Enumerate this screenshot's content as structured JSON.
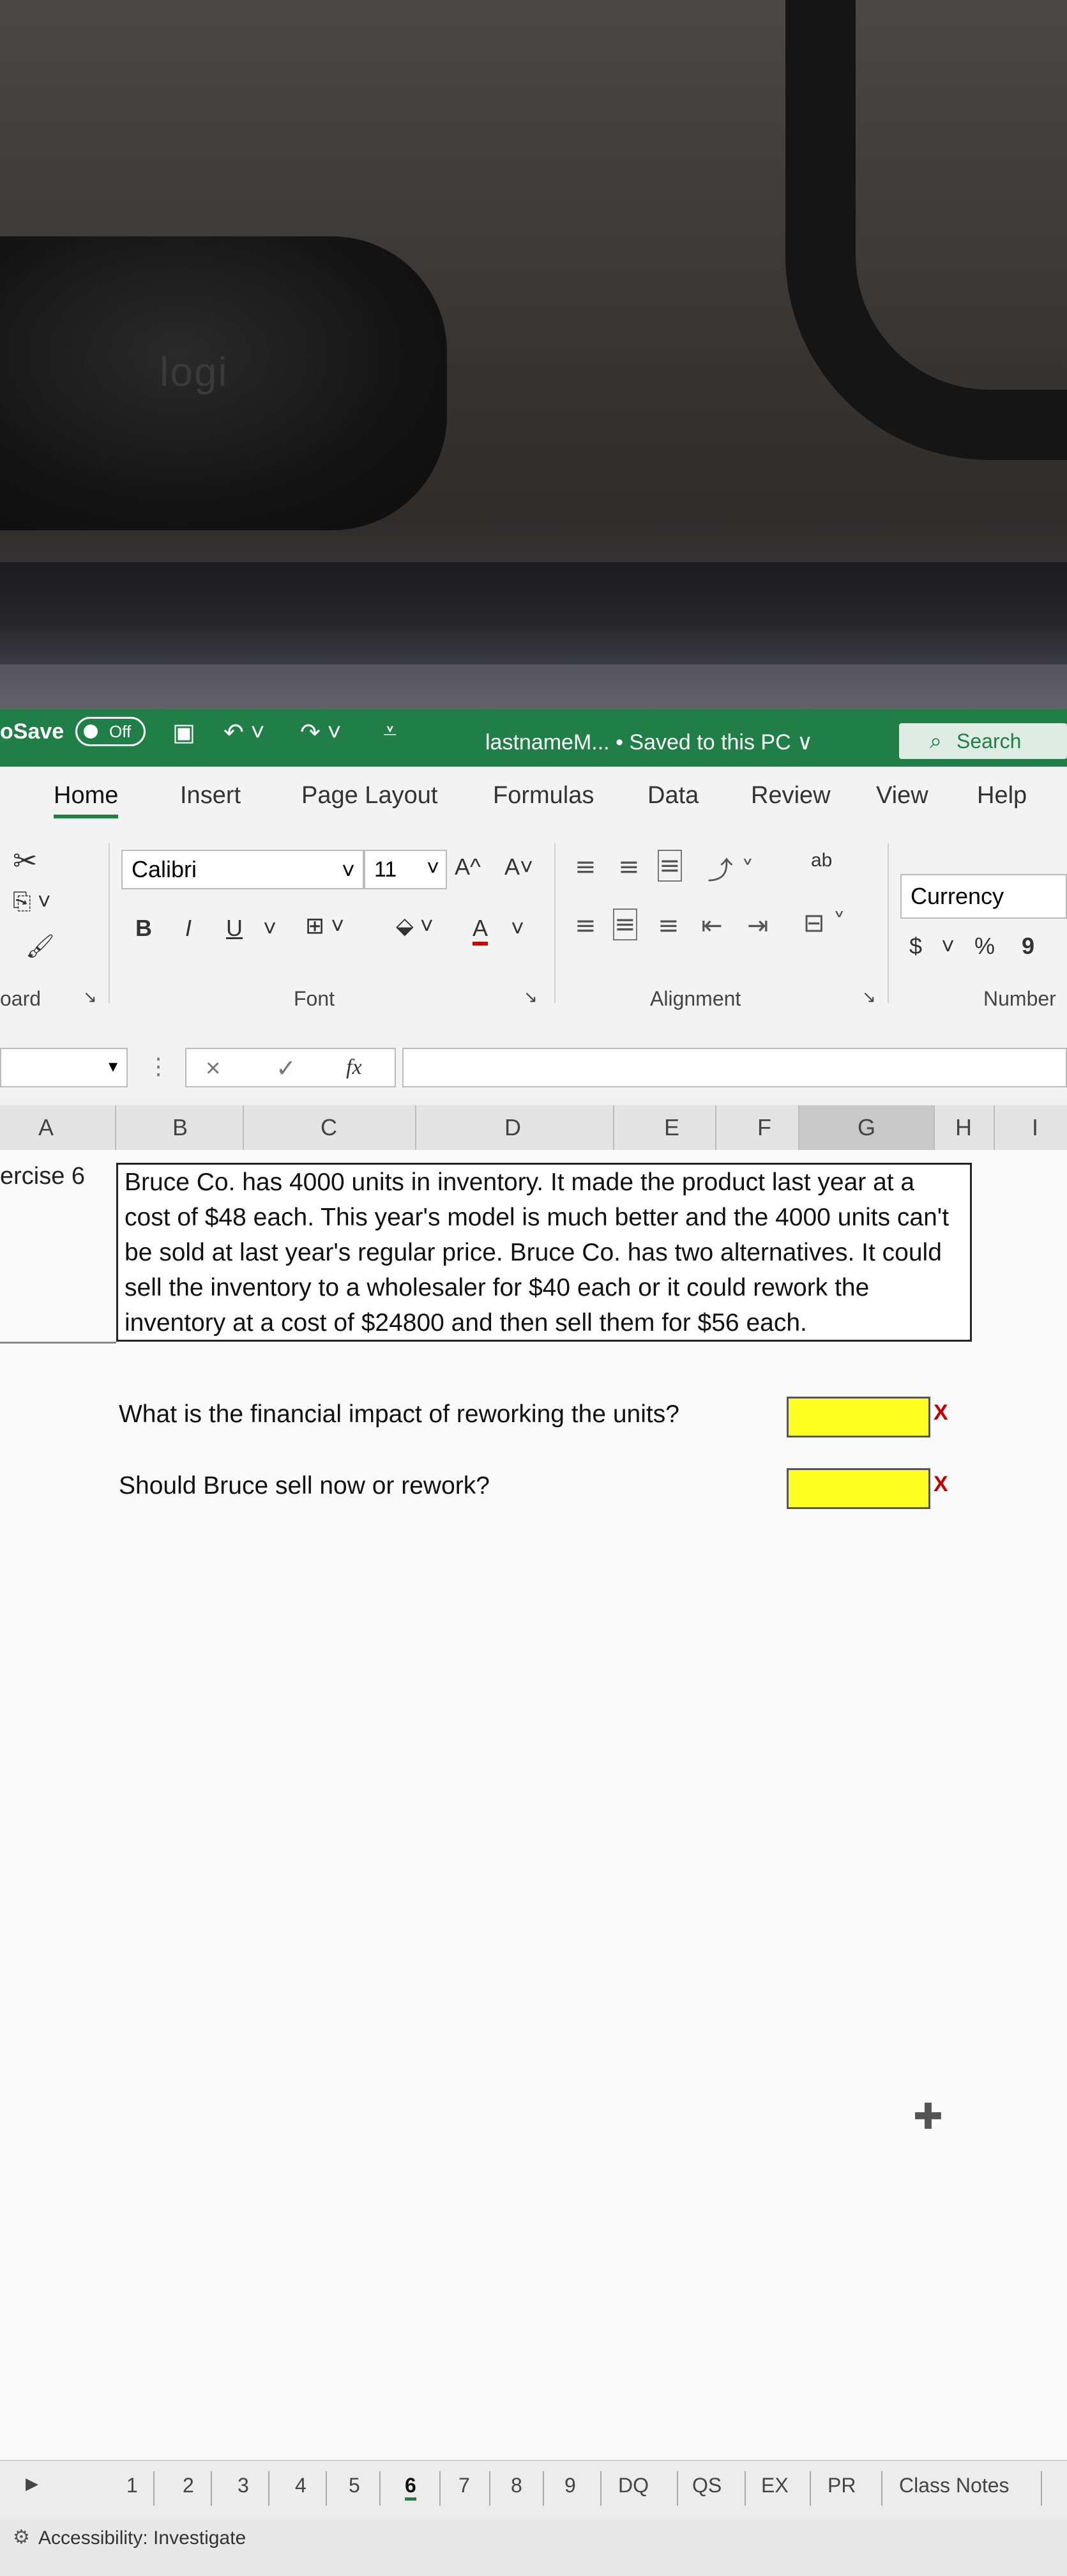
{
  "backdrop": {
    "webcam_brand": "logi"
  },
  "titlebar": {
    "autosave_label": "oSave",
    "autosave_state": "Off",
    "filename": "lastnameM...  • Saved to this PC ∨",
    "search_label": "Search"
  },
  "tabs": [
    "Home",
    "Insert",
    "Page Layout",
    "Formulas",
    "Data",
    "Review",
    "View",
    "Help"
  ],
  "ribbon": {
    "clipboard_label": "oard",
    "font_name": "Calibri",
    "font_size": "11",
    "grow_font": "A^",
    "shrink_font": "A˅",
    "bold": "B",
    "italic": "I",
    "underline": "U",
    "font_color": "A",
    "font_group_label": "Font",
    "wrap_text_icon": "ab",
    "alignment_group_label": "Alignment",
    "number_format": "Currency",
    "currency_symbol": "$",
    "percent_symbol": "%",
    "comma_symbol": "9",
    "number_group_label": "Number"
  },
  "formula_bar": {
    "cancel": "×",
    "enter": "✓",
    "fx": "fx",
    "value": ""
  },
  "columns": [
    "A",
    "B",
    "C",
    "D",
    "E",
    "F",
    "G",
    "H",
    "I"
  ],
  "sheet": {
    "row_label": "ercise 6",
    "problem_lines": [
      "Bruce Co. has 4000 units in inventory.  It made the product last year at a",
      "cost of $48 each. This year's model is much better and the 4000 units can't",
      "be sold at last year's regular price.  Bruce Co. has two alternatives.  It could",
      "sell the inventory to a wholesaler for $40 each or it could rework the",
      "inventory at a cost of $24800 and then sell them for $56 each."
    ],
    "question_1": "What is the financial impact of reworking the units?",
    "question_2": "Should Bruce sell now or rework?",
    "answer_1": "",
    "answer_2": "",
    "mark_1": "X",
    "mark_2": "X"
  },
  "sheet_tabs": [
    "1",
    "2",
    "3",
    "4",
    "5",
    "6",
    "7",
    "8",
    "9",
    "DQ",
    "QS",
    "EX",
    "PR",
    "Class Notes"
  ],
  "active_sheet": "6",
  "status": {
    "accessibility": "Accessibility: Investigate"
  },
  "colors": {
    "excel_green": "#1f7f46",
    "answer_fill": "#ffff22",
    "error_mark": "#c00000"
  }
}
